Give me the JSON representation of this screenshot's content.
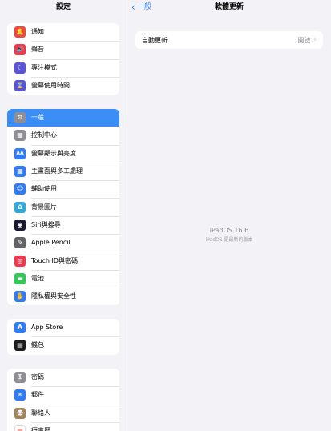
{
  "sidebar": {
    "title": "設定",
    "groups": [
      {
        "items": [
          {
            "label": "通知",
            "icon": "bell-icon",
            "color": "#f04a3e",
            "glyph": "🔔"
          },
          {
            "label": "聲音",
            "icon": "speaker-icon",
            "color": "#f0394f",
            "glyph": "🔊"
          },
          {
            "label": "專注模式",
            "icon": "moon-icon",
            "color": "#5b55d6",
            "glyph": "☾"
          },
          {
            "label": "螢幕使用時間",
            "icon": "hourglass-icon",
            "color": "#5b55d6",
            "glyph": "⌛"
          }
        ]
      },
      {
        "items": [
          {
            "label": "一般",
            "icon": "gear-icon",
            "color": "#8e8e93",
            "glyph": "⚙",
            "selected": true
          },
          {
            "label": "控制中心",
            "icon": "control-center-icon",
            "color": "#8e8e93",
            "glyph": "▦"
          },
          {
            "label": "螢幕顯示與亮度",
            "icon": "brightness-icon",
            "color": "#2f7cf6",
            "glyph": "AA"
          },
          {
            "label": "主畫面與多工處理",
            "icon": "home-screen-icon",
            "color": "#2f7cf6",
            "glyph": "▦"
          },
          {
            "label": "輔助使用",
            "icon": "accessibility-icon",
            "color": "#2f7cf6",
            "glyph": "☺"
          },
          {
            "label": "背景圖片",
            "icon": "wallpaper-icon",
            "color": "#34aadc",
            "glyph": "✿"
          },
          {
            "label": "Siri與搜尋",
            "icon": "siri-icon",
            "color": "#1a1a2e",
            "glyph": "◉"
          },
          {
            "label": "Apple Pencil",
            "icon": "pencil-icon",
            "color": "#636366",
            "glyph": "✎"
          },
          {
            "label": "Touch ID與密碼",
            "icon": "fingerprint-icon",
            "color": "#f0394f",
            "glyph": "◎"
          },
          {
            "label": "電池",
            "icon": "battery-icon",
            "color": "#34c759",
            "glyph": "▬"
          },
          {
            "label": "隱私權與安全性",
            "icon": "privacy-hand-icon",
            "color": "#2f7cf6",
            "glyph": "✋"
          }
        ]
      },
      {
        "items": [
          {
            "label": "App Store",
            "icon": "app-store-icon",
            "color": "#2f7cf6",
            "glyph": "A"
          },
          {
            "label": "錢包",
            "icon": "wallet-icon",
            "color": "#1c1c1e",
            "glyph": "▤"
          }
        ]
      },
      {
        "items": [
          {
            "label": "密碼",
            "icon": "key-icon",
            "color": "#8e8e93",
            "glyph": "⚿"
          },
          {
            "label": "郵件",
            "icon": "mail-icon",
            "color": "#2f7cf6",
            "glyph": "✉"
          },
          {
            "label": "聯絡人",
            "icon": "contacts-icon",
            "color": "#a2845e",
            "glyph": "☻"
          },
          {
            "label": "行事曆",
            "icon": "calendar-icon",
            "color": "#ffffff",
            "glyph": "▤"
          }
        ]
      }
    ]
  },
  "detail": {
    "back_label": "一般",
    "title": "軟體更新",
    "row_label": "自動更新",
    "row_value": "開啟",
    "os_name": "iPadOS 16.6",
    "os_status": "iPadOS 是最新的版本"
  }
}
